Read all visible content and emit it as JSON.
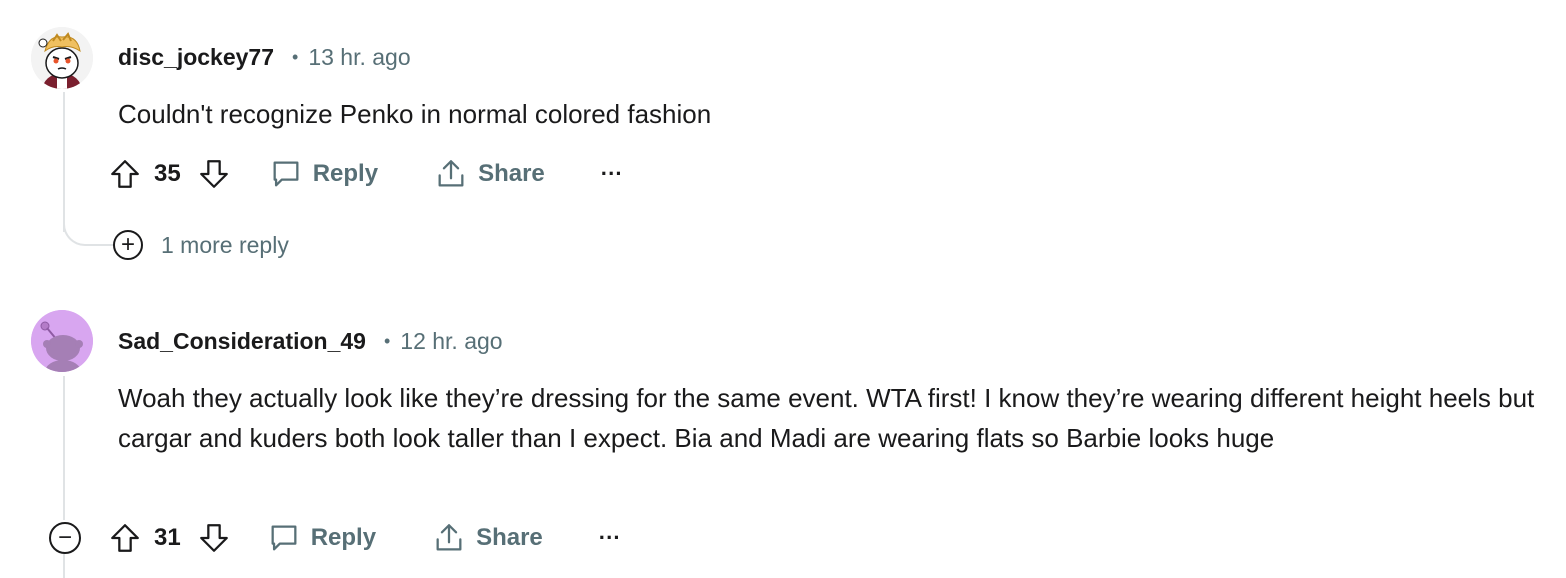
{
  "comments": [
    {
      "username": "disc_jockey77",
      "separator": "•",
      "time": "13 hr. ago",
      "text": "Couldn't recognize Penko in normal colored fashion",
      "votes": "35",
      "reply_label": "Reply",
      "share_label": "Share",
      "more_label": "···",
      "more_replies": "1 more reply"
    },
    {
      "username": "Sad_Consideration_49",
      "separator": "•",
      "time": "12 hr. ago",
      "text": "Woah they actually look like they’re dressing for the same event. WTA first! I know they’re wearing different height heels but cargar and kuders both look taller than I expect. Bia and Madi are wearing flats so Barbie looks huge",
      "votes": "31",
      "reply_label": "Reply",
      "share_label": "Share",
      "more_label": "···",
      "collapse_symbol": "−"
    }
  ],
  "colors": {
    "text": "#1a1a1b",
    "meta": "#576f76",
    "thread_line": "#e0e3e5",
    "avatar2_bg": "#d8a6f0"
  }
}
